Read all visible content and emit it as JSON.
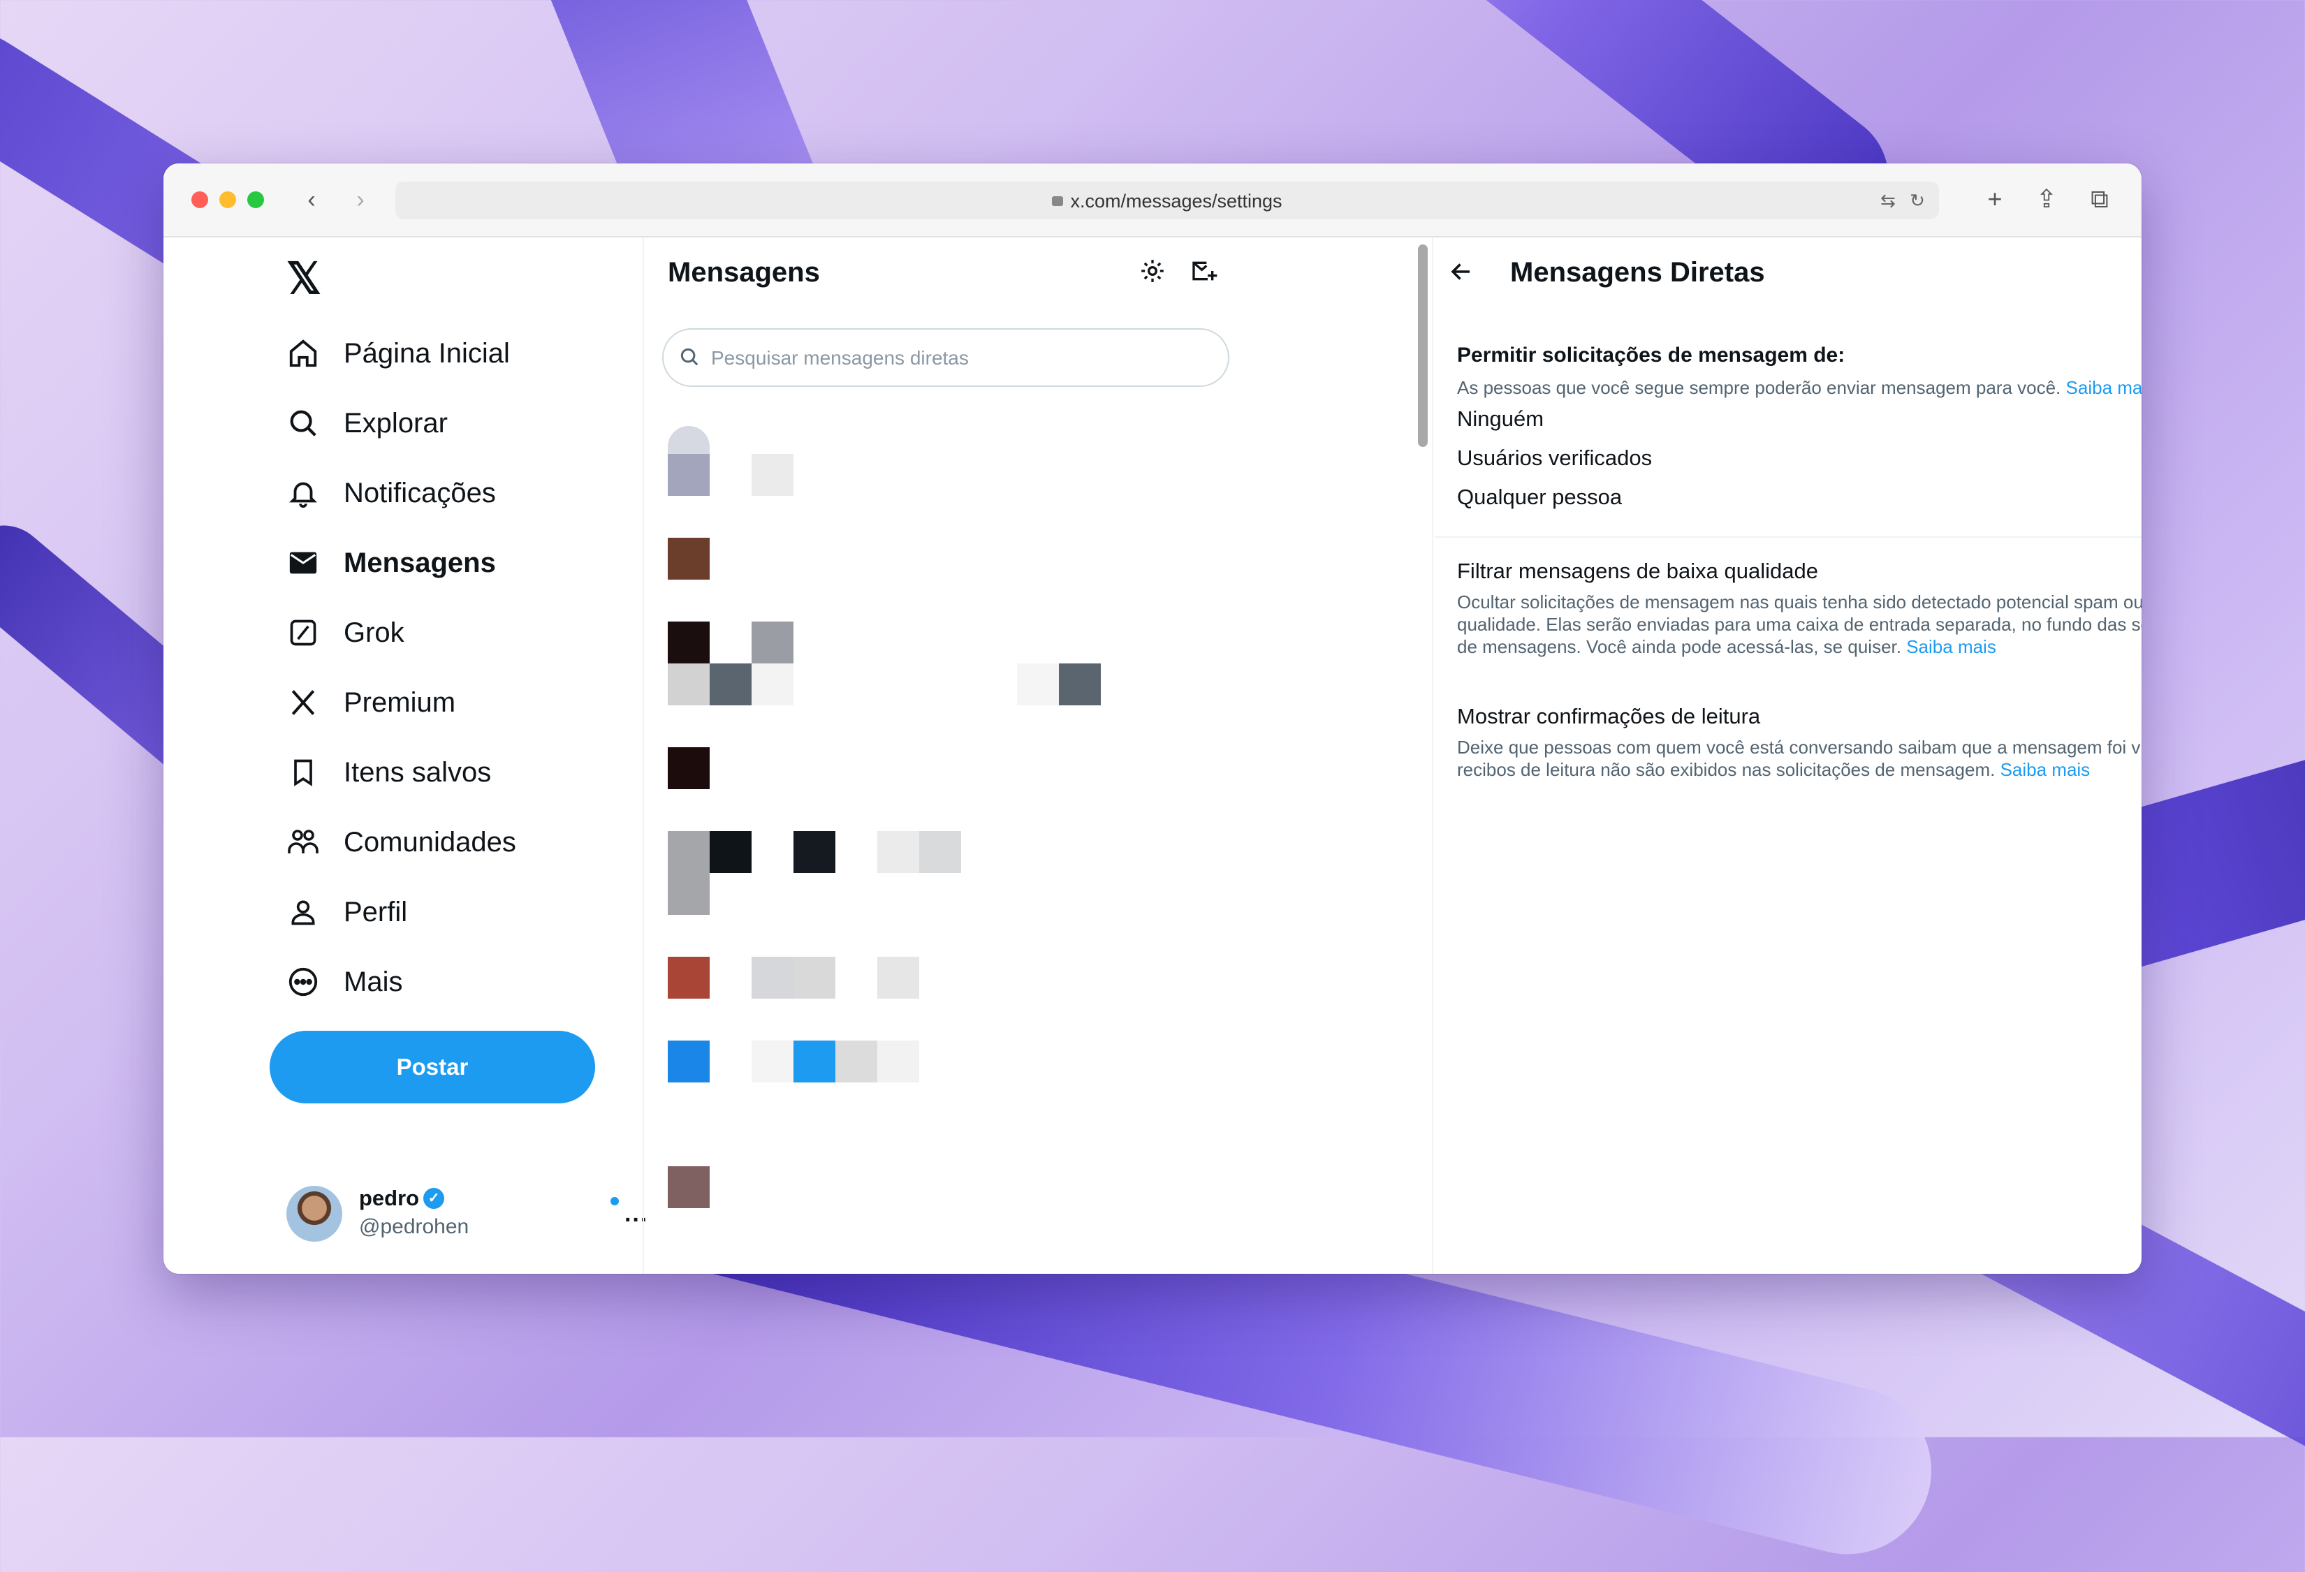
{
  "browser": {
    "url": "x.com/messages/settings"
  },
  "nav": {
    "items": [
      {
        "label": "Página Inicial",
        "icon": "home-icon"
      },
      {
        "label": "Explorar",
        "icon": "search-icon"
      },
      {
        "label": "Notificações",
        "icon": "bell-icon"
      },
      {
        "label": "Mensagens",
        "icon": "envelope-icon",
        "active": true
      },
      {
        "label": "Grok",
        "icon": "grok-icon"
      },
      {
        "label": "Premium",
        "icon": "x-logo-icon"
      },
      {
        "label": "Itens salvos",
        "icon": "bookmark-icon"
      },
      {
        "label": "Comunidades",
        "icon": "communities-icon"
      },
      {
        "label": "Perfil",
        "icon": "person-icon"
      },
      {
        "label": "Mais",
        "icon": "more-circle-icon"
      }
    ],
    "post_label": "Postar"
  },
  "profile": {
    "name": "pedro",
    "handle": "@pedrohen"
  },
  "messages": {
    "title": "Mensagens",
    "search_placeholder": "Pesquisar mensagens diretas"
  },
  "dm_settings": {
    "title": "Mensagens Diretas",
    "allow_heading": "Permitir solicitações de mensagem de:",
    "allow_sub": "As pessoas que você segue sempre poderão enviar mensagem para você.",
    "learn_more": "Saiba mais",
    "options": [
      {
        "label": "Ninguém",
        "selected": false
      },
      {
        "label": "Usuários verificados",
        "selected": false
      },
      {
        "label": "Qualquer pessoa",
        "selected": true
      }
    ],
    "filter": {
      "label": "Filtrar mensagens de baixa qualidade",
      "description": "Ocultar solicitações de mensagem nas quais tenha sido detectado potencial spam ou baixa qualidade. Elas serão enviadas para uma caixa de entrada separada, no fundo das solicitações de mensagens. Você ainda pode acessá-las, se quiser.",
      "checked": false
    },
    "receipts": {
      "label": "Mostrar confirmações de leitura",
      "description": "Deixe que pessoas com quem você está conversando saibam que a mensagem foi vista. Os recibos de leitura não são exibidos nas solicitações de mensagem.",
      "checked": true
    }
  },
  "colors": {
    "accent": "#1d9bf0",
    "text": "#0f1419",
    "muted": "#536471"
  }
}
